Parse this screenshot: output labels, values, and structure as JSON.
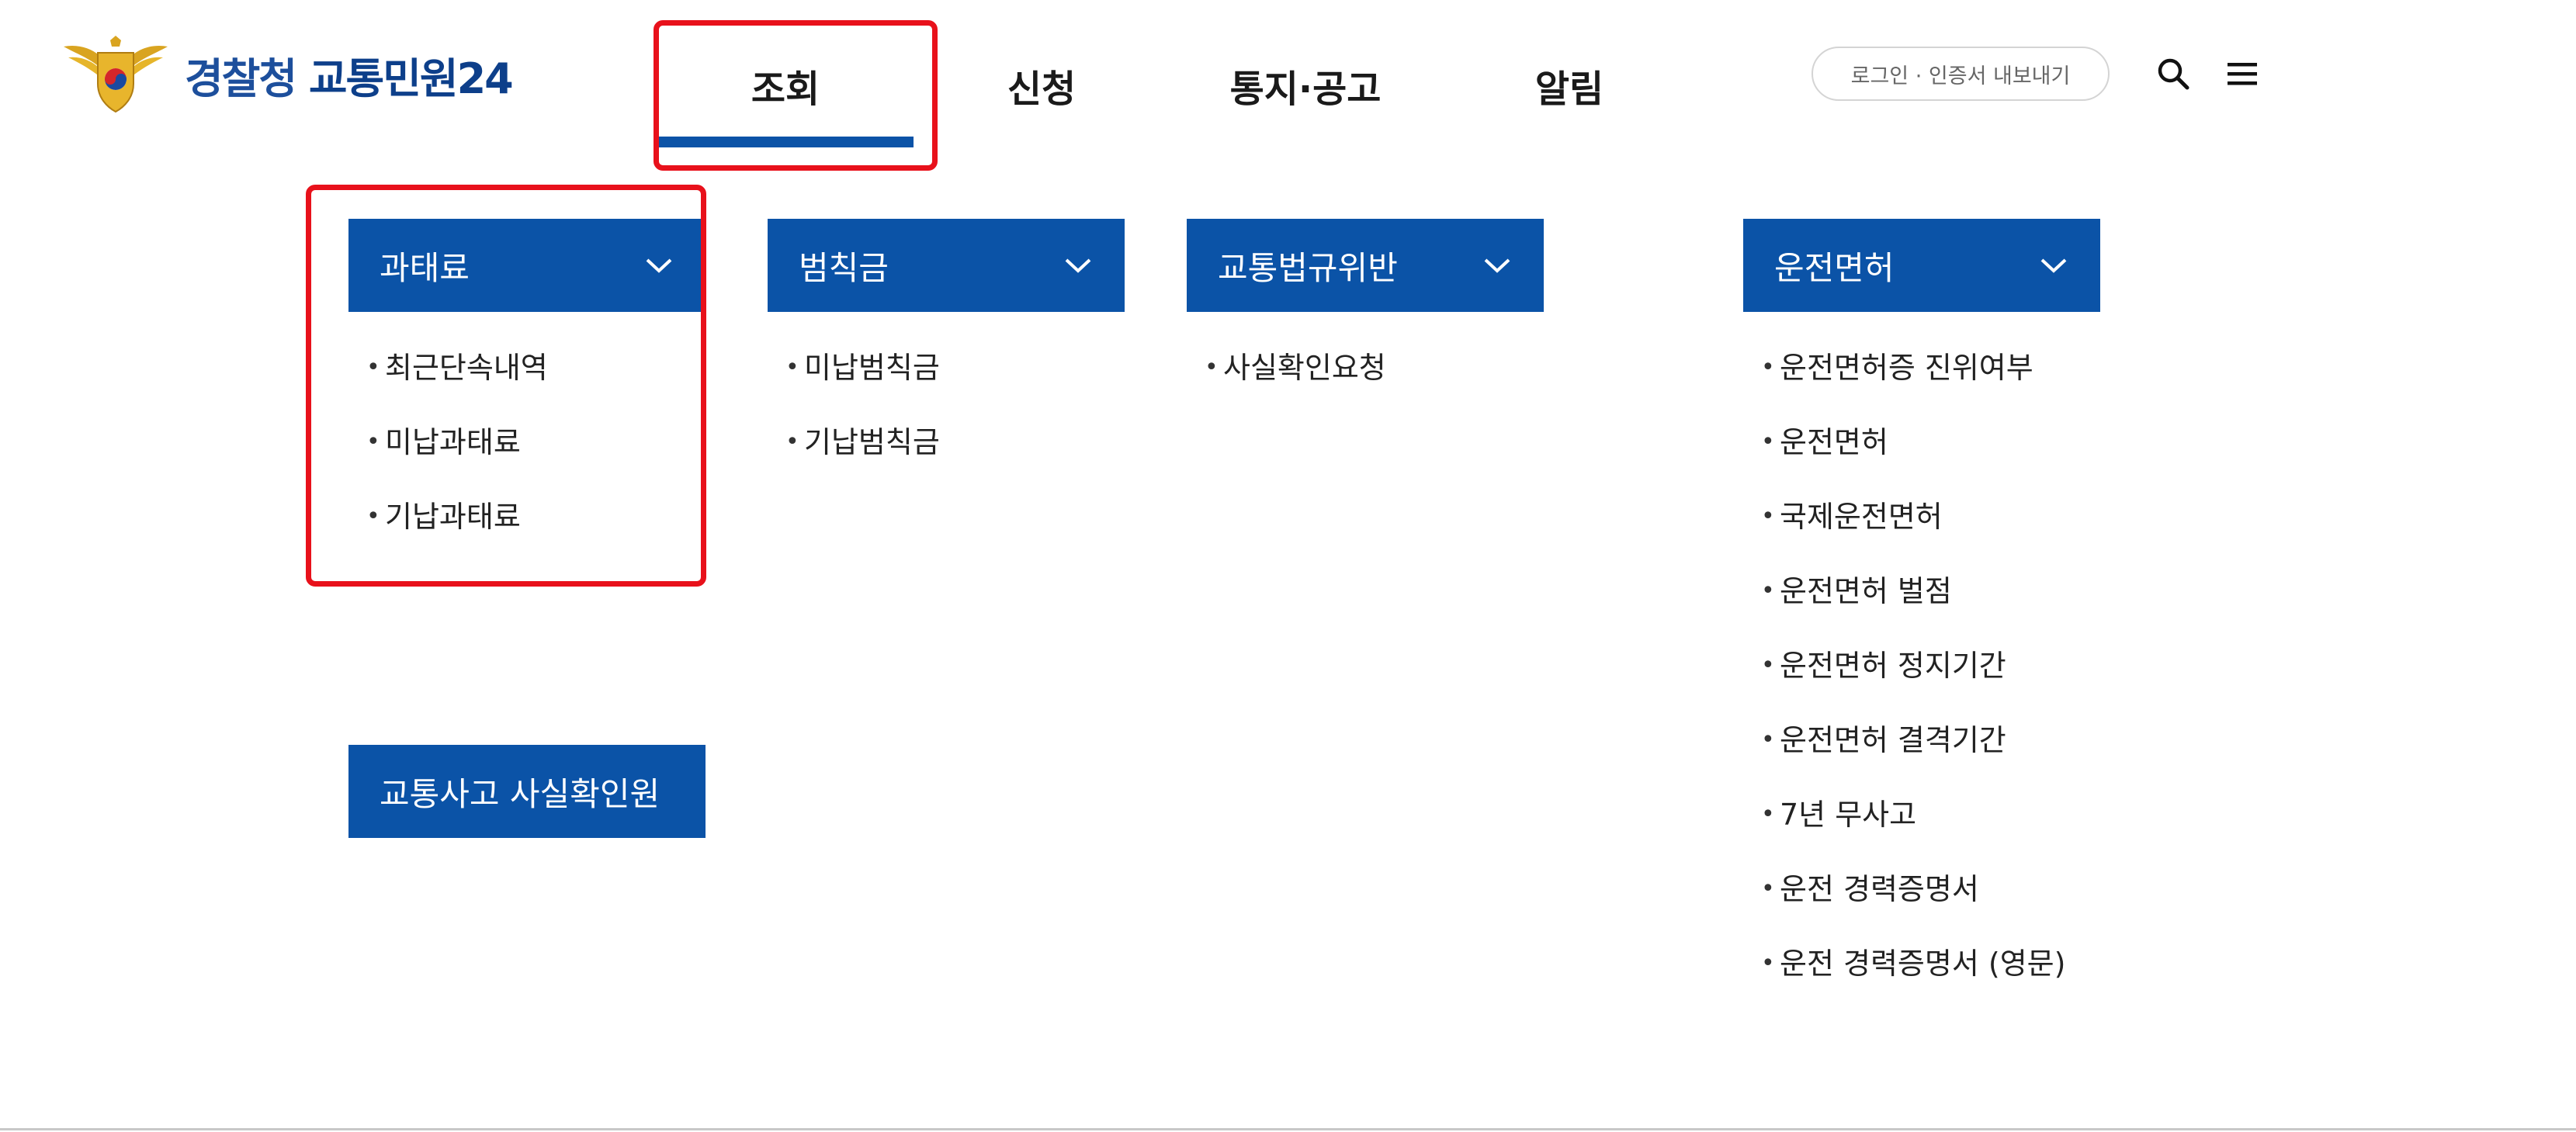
{
  "header": {
    "logo": {
      "part1": "경찰청",
      "part2": "교통민원24"
    },
    "tabs": [
      {
        "label": "조회",
        "active": true
      },
      {
        "label": "신청"
      },
      {
        "label": "통지·공고"
      },
      {
        "label": "알림"
      }
    ],
    "login_label": "로그인 · 인증서 내보내기",
    "icons": {
      "search": "search-icon",
      "menu": "hamburger-menu-icon",
      "logo": "police-emblem-icon"
    }
  },
  "menu": {
    "categories": [
      {
        "label": "과태료",
        "items": [
          "최근단속내역",
          "미납과태료",
          "기납과태료"
        ]
      },
      {
        "label": "범칙금",
        "items": [
          "미납범칙금",
          "기납범칙금"
        ]
      },
      {
        "label": "교통법규위반",
        "items": [
          "사실확인요청"
        ]
      },
      {
        "label": "운전면허",
        "items": [
          "운전면허증 진위여부",
          "운전면허",
          "국제운전면허",
          "운전면허 벌점",
          "운전면허 정지기간",
          "운전면허 결격기간",
          "7년 무사고",
          "운전 경력증명서",
          "운전 경력증명서 (영문)"
        ]
      }
    ],
    "accident_button": "교통사고 사실확인원",
    "bullet": "•"
  },
  "colors": {
    "primary": "#0b53a7",
    "highlight": "#e8111b",
    "logo_text": "#1d4f9c"
  }
}
